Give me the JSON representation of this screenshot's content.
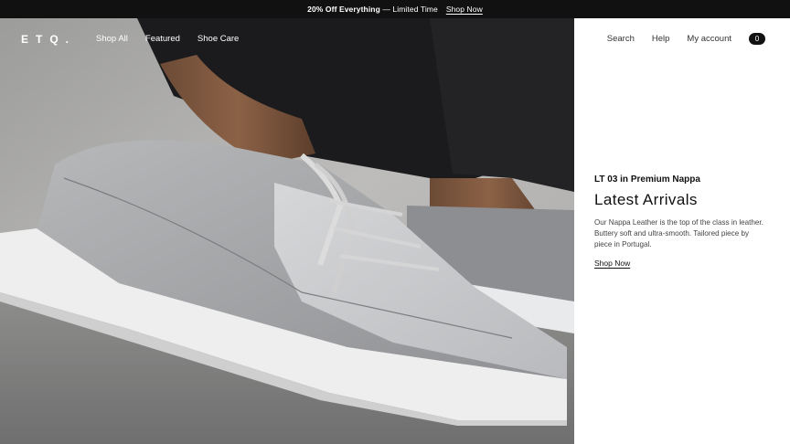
{
  "promo": {
    "bold": "20% Off Everything",
    "rest": " — Limited Time",
    "link": "Shop Now"
  },
  "header": {
    "logo": "ETQ.",
    "nav": [
      "Shop All",
      "Featured",
      "Shoe Care"
    ],
    "search": "Search",
    "help": "Help",
    "account": "My account",
    "cart_count": "0"
  },
  "hero": {
    "image_subject": "grey leather low-top sneaker on a foot"
  },
  "feature": {
    "kicker": "LT 03 in Premium Nappa",
    "headline": "Latest Arrivals",
    "description": "Our Nappa Leather is the top of the class in leather. Buttery soft and ultra-smooth. Tailored piece by piece in Portugal.",
    "cta": "Shop Now"
  },
  "colors": {
    "promo_bg": "#111111",
    "panel_bg": "#ffffff",
    "text": "#111111"
  }
}
